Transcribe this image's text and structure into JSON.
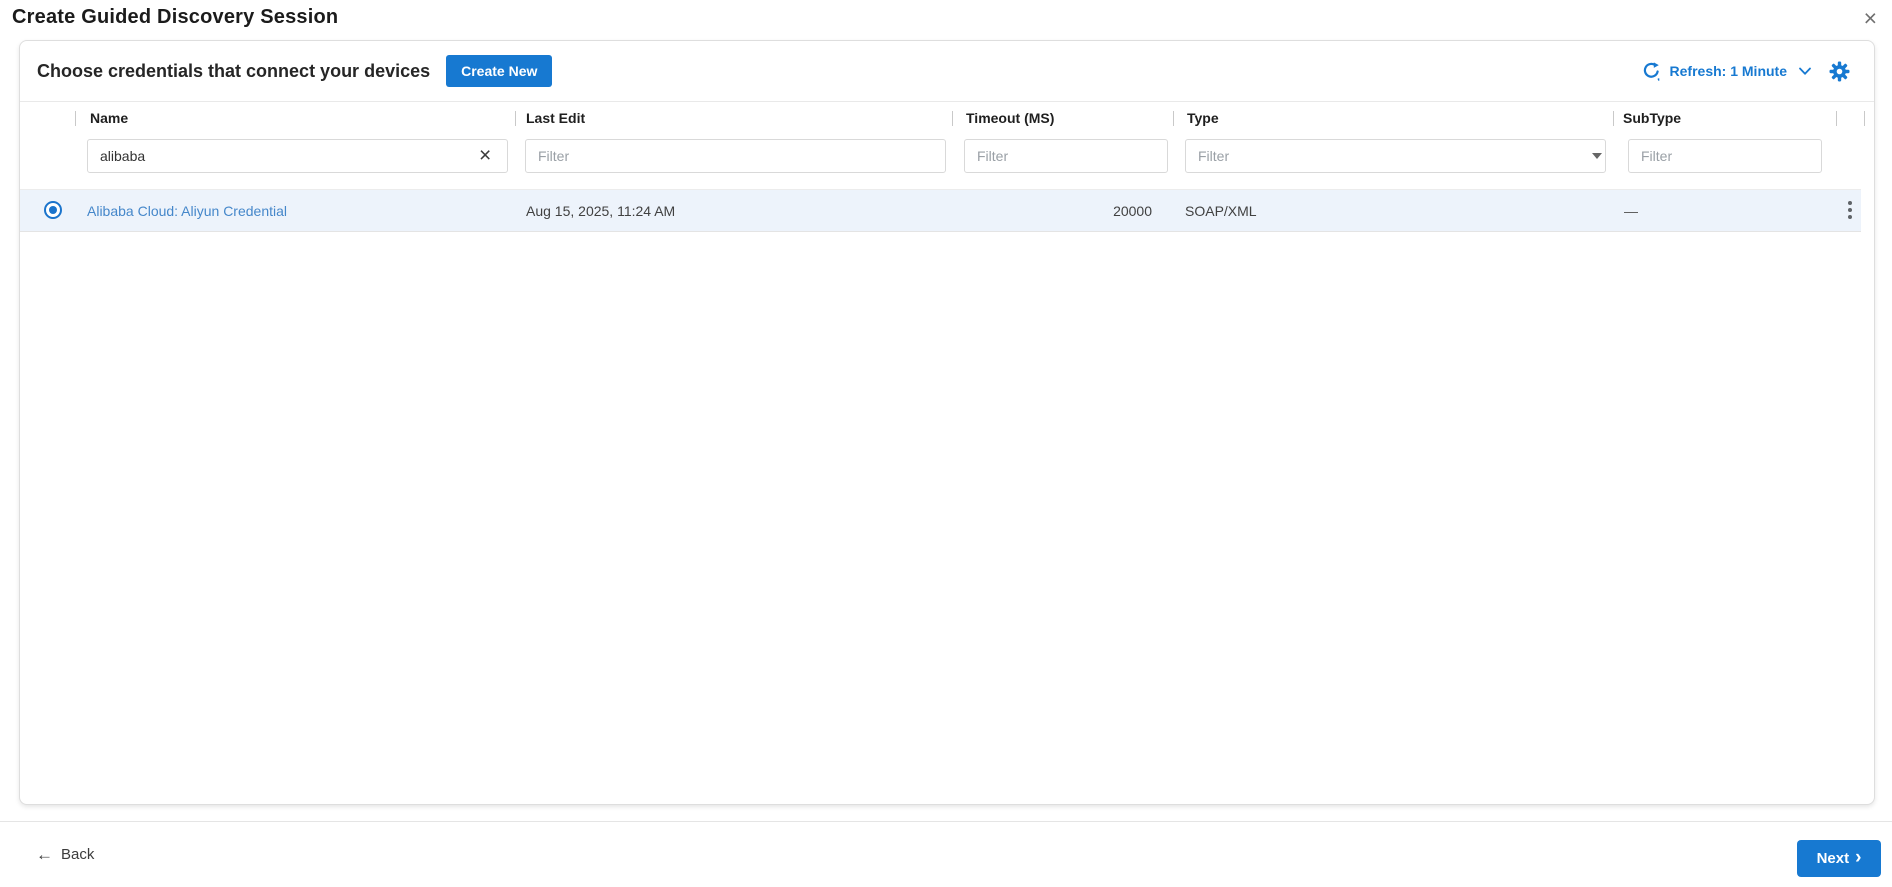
{
  "dialog": {
    "title": "Create Guided Discovery Session"
  },
  "panel": {
    "heading": "Choose credentials that connect your devices",
    "create_new_label": "Create New",
    "refresh_label": "Refresh: 1 Minute"
  },
  "table": {
    "columns": [
      {
        "key": "name",
        "label": "Name",
        "filter_value": "alibaba",
        "filter_placeholder": "Filter"
      },
      {
        "key": "last_edit",
        "label": "Last Edit",
        "filter_value": "",
        "filter_placeholder": "Filter"
      },
      {
        "key": "timeout_ms",
        "label": "Timeout (MS)",
        "filter_value": "",
        "filter_placeholder": "Filter"
      },
      {
        "key": "type",
        "label": "Type",
        "filter_value": "",
        "filter_placeholder": "Filter",
        "filter_kind": "dropdown"
      },
      {
        "key": "subtype",
        "label": "SubType",
        "filter_value": "",
        "filter_placeholder": "Filter"
      }
    ],
    "rows": [
      {
        "selected": true,
        "name": "Alibaba Cloud: Aliyun Credential",
        "last_edit": "Aug 15, 2025, 11:24 AM",
        "timeout_ms": "20000",
        "type": "SOAP/XML",
        "subtype": "—"
      }
    ]
  },
  "footer": {
    "back_label": "Back",
    "next_label": "Next"
  },
  "icons": {
    "close": "×",
    "clear_filter": "×",
    "back_arrow": "←",
    "next_chevron": "›"
  },
  "colors": {
    "accent_blue": "#1779d1",
    "link_blue": "#4587ca",
    "selected_row_bg": "#edf3fb",
    "radio_blue": "#1b74cc"
  }
}
